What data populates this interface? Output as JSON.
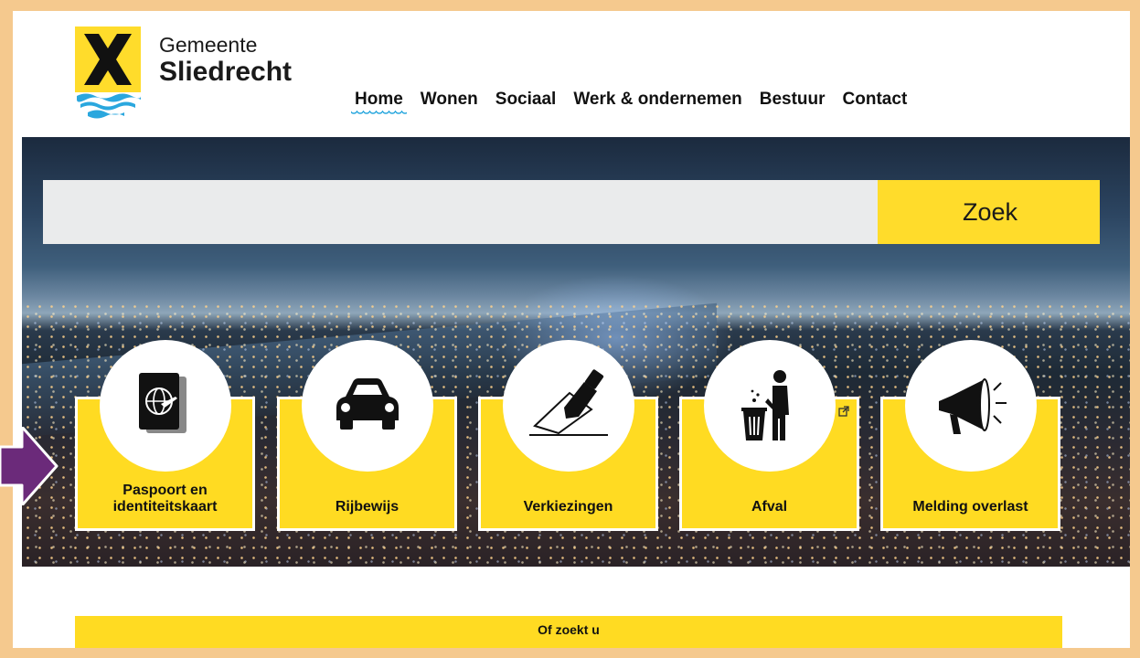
{
  "header": {
    "brand_line1": "Gemeente",
    "brand_line2": "Sliedrecht",
    "nav": [
      {
        "label": "Home",
        "active": true
      },
      {
        "label": "Wonen"
      },
      {
        "label": "Sociaal"
      },
      {
        "label": "Werk & ondernemen"
      },
      {
        "label": "Bestuur"
      },
      {
        "label": "Contact"
      }
    ]
  },
  "search": {
    "placeholder": "",
    "button_label": "Zoek"
  },
  "tiles": [
    {
      "label": "Paspoort en identiteitskaart",
      "icon": "passport-icon"
    },
    {
      "label": "Rijbewijs",
      "icon": "car-icon"
    },
    {
      "label": "Verkiezingen",
      "icon": "ballot-vote-icon"
    },
    {
      "label": "Afval",
      "icon": "waste-bin-icon",
      "external": true
    },
    {
      "label": "Melding overlast",
      "icon": "megaphone-icon"
    }
  ],
  "colors": {
    "accent_yellow": "#ffdb22",
    "frame": "#f5c98e",
    "arrow": "#6b2a7a",
    "underline_blue": "#2aa7de"
  },
  "bottom": {
    "heading": "Of zoekt u"
  }
}
